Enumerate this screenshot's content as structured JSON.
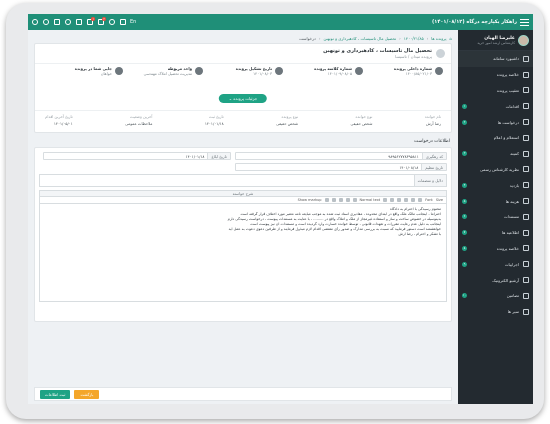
{
  "app": {
    "title": "راهکار یکپارچه درگاه (۱۴۰۱/۰۸/۱۲)",
    "lang": "En"
  },
  "user": {
    "name": "علیرضا الهیان",
    "role": "کارشناس ارشد امور خرید"
  },
  "topbar_icons": [
    "power-icon",
    "settings-icon",
    "sitemap-icon",
    "user-icon",
    "document-icon",
    "calendar-icon",
    "message-icon",
    "eye-icon",
    "help-icon"
  ],
  "sidebar": {
    "items": [
      {
        "label": "داشبورد سامانه",
        "bullet": ""
      },
      {
        "label": "خلاصه پرونده",
        "bullet": ""
      },
      {
        "label": "تعقیب پرونده",
        "bullet": ""
      },
      {
        "label": "اقدامات",
        "bullet": "۱"
      },
      {
        "label": "درخواست ها",
        "bullet": "۲"
      },
      {
        "label": "استعلام و اعلام",
        "bullet": ""
      },
      {
        "label": "کمیته",
        "bullet": "۳"
      },
      {
        "label": "نظریه کارشناس رسمی",
        "bullet": ""
      },
      {
        "label": "بازدید",
        "bullet": "۴"
      },
      {
        "label": "هزینه ها",
        "bullet": "۵"
      },
      {
        "label": "مستندات",
        "bullet": "۶"
      },
      {
        "label": "اطلاعیه ها",
        "bullet": "۷"
      },
      {
        "label": "خلاصه پرونده",
        "bullet": "۸"
      },
      {
        "label": "اجراییات",
        "bullet": "۹"
      },
      {
        "label": "آرشیو الکترونیک",
        "bullet": ""
      },
      {
        "label": "تضامین",
        "bullet": "۱۰"
      },
      {
        "label": "سیر ها",
        "bullet": ""
      }
    ]
  },
  "breadcrumb": [
    "پرونده ها",
    "۱۴۰۰/۲۱/۸۵",
    "تحصیل مال تاسیسات ، کادهبرداری و تونهبن",
    "درخواست"
  ],
  "case": {
    "title": "تحصیل مال تاسیسات ، کادهبرداری و تونهبن",
    "subtitle": "پرونده میدان / تاسیسا",
    "meta": [
      {
        "label": "شماره داخلی پرونده",
        "value": "۱۴۰۰/۸۵/۰۲۱/۰۳"
      },
      {
        "label": "شماره کلاسه پرونده",
        "value": "۱۴۰۱/۰۹/۰۸/۰۵"
      },
      {
        "label": "تاریخ تشکیل پرونده",
        "value": "۱۴۰۱/۰۸/۰۳"
      },
      {
        "label": "واحد مربوطه",
        "value": "مدیریت تحصیل املاک مهندسی"
      },
      {
        "label": "جایی شما در پرونده",
        "value": "خواهان"
      }
    ],
    "details_button": "جزئیات پرونده",
    "info": [
      {
        "label": "نام خوانده",
        "value": "رضا آرش"
      },
      {
        "label": "نوع خوانده",
        "value": "شخص حقیقی"
      },
      {
        "label": "نوع پرونده",
        "value": "شخص حقیقی"
      },
      {
        "label": "تاریخ ثبت",
        "value": "۱۴۰۱/۰۱/۱۸"
      },
      {
        "label": "آخرین وضعیت",
        "value": "ملاحظات عمومی"
      },
      {
        "label": "تاریخ آخرین اقدام",
        "value": "۱۴۰۱/۰۵/۰۱"
      }
    ]
  },
  "form": {
    "section_title": "اطلاعات درخواست",
    "code_label": "کد رهگیری",
    "code_value": "۹۸۹۵۶۲۷۷۸۳۹۵۸۱۱",
    "register_label": "تاریخ ابلاغ",
    "register_value": "۱۴۰۱/۰۱/۱۸",
    "submit_label": "تاریخ تنظیم",
    "submit_value": "۱۴۰۱/۰۸/۱۸",
    "attach_label": "دلایل و منضمات",
    "editor_label": "شرح خواسته",
    "toolbar_font": "Font",
    "toolbar_size": "Size",
    "toolbar_format": "Normal text",
    "toolbar_markup": "Show markup",
    "editor_lines": [
      "محتوم رسیدگی با احترام به دادگاه",
      "احتراماً ، اینجانب مالک ملک واقع در ابتدای محدوده ، مقادیری اسناد ثبت‌ شده به موجب مبایعه نامه معتبر مورد اختلاف قرار گرفته است",
      "بدینوسیله در خصوص ساخت و ساز و استفاده غیرمجاز از ملک و املاک واقع در ......... ، با عنایت به مستندات پیوست ، درخواست رسیدگی دارم",
      "اینجانب به دلیل عدم رعایت مقررات و تعهدات قانونی ، توسط خوانده خسارت وارد گردیده است و مستندات آن نیز پیوست است",
      "خواهشمند است دستور فرمایید که نسبت به بررسی مدارک و صدور رأی مقتضی اقدام لازم مبذول فرمایند و از طرفین دعوی دعوت به عمل آید",
      "با تشکر و احترام ، رضا آرش"
    ]
  },
  "footer": {
    "save": "ثبت اطلاعات",
    "back": "بازگشت"
  }
}
